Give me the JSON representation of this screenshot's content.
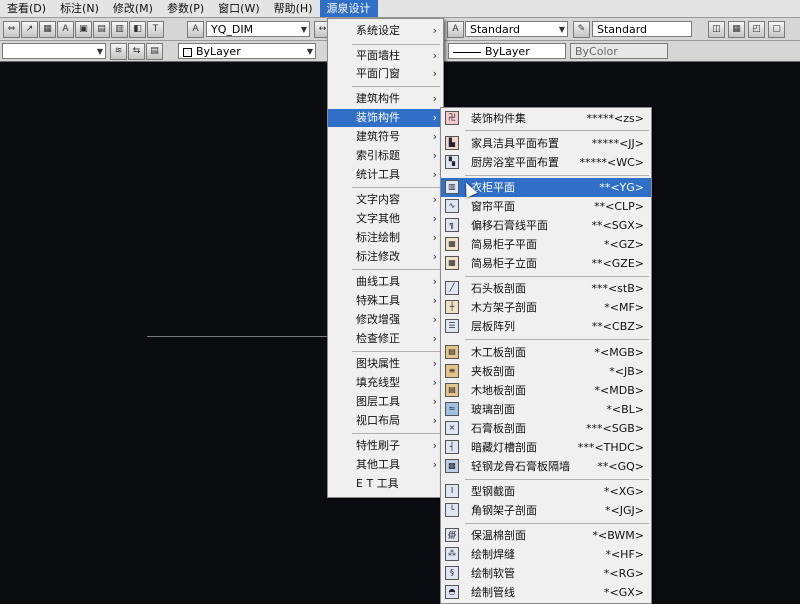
{
  "menubar": {
    "items": [
      {
        "label": "查看(D)"
      },
      {
        "label": "标注(N)"
      },
      {
        "label": "修改(M)"
      },
      {
        "label": "参数(P)"
      },
      {
        "label": "窗口(W)"
      },
      {
        "label": "帮助(H)"
      },
      {
        "label": "源泉设计"
      }
    ]
  },
  "toolbar1": {
    "dim_style": "YQ_DIM",
    "text_style": "Standard",
    "table_style": "Standard"
  },
  "toolbar2": {
    "layer_color": "ByLayer",
    "linetype": "ByLayer",
    "plot_style": "ByColor"
  },
  "main_menu": {
    "items": [
      {
        "label": "系统设定",
        "has_sub": true
      },
      {
        "label": "平面墙柱",
        "has_sub": true
      },
      {
        "label": "平面门窗",
        "has_sub": true
      },
      {
        "label": "建筑构件",
        "has_sub": true
      },
      {
        "label": "装饰构件",
        "has_sub": true,
        "highlighted": true
      },
      {
        "label": "建筑符号",
        "has_sub": true
      },
      {
        "label": "索引标题",
        "has_sub": true
      },
      {
        "label": "统计工具",
        "has_sub": true
      },
      {
        "label": "文字内容",
        "has_sub": true
      },
      {
        "label": "文字其他",
        "has_sub": true
      },
      {
        "label": "标注绘制",
        "has_sub": true
      },
      {
        "label": "标注修改",
        "has_sub": true
      },
      {
        "label": "曲线工具",
        "has_sub": true
      },
      {
        "label": "特殊工具",
        "has_sub": true
      },
      {
        "label": "修改增强",
        "has_sub": true
      },
      {
        "label": "检查修正",
        "has_sub": true
      },
      {
        "label": "图块属性",
        "has_sub": true
      },
      {
        "label": "填充线型",
        "has_sub": true
      },
      {
        "label": "图层工具",
        "has_sub": true
      },
      {
        "label": "视口布局",
        "has_sub": true
      },
      {
        "label": "特性刷子",
        "has_sub": true
      },
      {
        "label": "其他工具",
        "has_sub": true
      },
      {
        "label": "E T 工具",
        "has_sub": false
      }
    ]
  },
  "sub_menu": {
    "items": [
      {
        "label": "装饰构件集",
        "code": "*****<zs>",
        "icon": "decor-set-icon"
      },
      {
        "label": "家具洁具平面布置",
        "code": "*****<JJ>",
        "icon": "furniture-icon"
      },
      {
        "label": "厨房浴室平面布置",
        "code": "*****<WC>",
        "icon": "kitchen-icon"
      },
      {
        "label": "衣柜平面",
        "code": "**<YG>",
        "icon": "wardrobe-icon",
        "highlighted": true
      },
      {
        "label": "窗帘平面",
        "code": "**<CLP>",
        "icon": "curtain-icon"
      },
      {
        "label": "偏移石膏线平面",
        "code": "**<SGX>",
        "icon": "gypsum-line-icon"
      },
      {
        "label": "简易柜子平面",
        "code": "*<GZ>",
        "icon": "cabinet-plan-icon"
      },
      {
        "label": "简易柜子立面",
        "code": "**<GZE>",
        "icon": "cabinet-elev-icon"
      },
      {
        "label": "石头板剖面",
        "code": "***<stB>",
        "icon": "stone-board-icon"
      },
      {
        "label": "木方架子剖面",
        "code": "*<MF>",
        "icon": "wood-frame-icon"
      },
      {
        "label": "层板阵列",
        "code": "**<CBZ>",
        "icon": "shelf-array-icon"
      },
      {
        "label": "木工板剖面",
        "code": "*<MGB>",
        "icon": "woodboard-icon"
      },
      {
        "label": "夹板剖面",
        "code": "*<JB>",
        "icon": "plywood-icon"
      },
      {
        "label": "木地板剖面",
        "code": "*<MDB>",
        "icon": "wood-floor-icon"
      },
      {
        "label": "玻璃剖面",
        "code": "*<BL>",
        "icon": "glass-icon"
      },
      {
        "label": "石膏板剖面",
        "code": "***<SGB>",
        "icon": "gypsum-board-icon"
      },
      {
        "label": "暗藏灯槽剖面",
        "code": "***<THDC>",
        "icon": "light-trough-icon"
      },
      {
        "label": "轻钢龙骨石膏板隔墙",
        "code": "**<GQ>",
        "icon": "steel-keel-icon"
      },
      {
        "label": "型钢截面",
        "code": "*<XG>",
        "icon": "steel-section-icon"
      },
      {
        "label": "角钢架子剖面",
        "code": "*<JGJ>",
        "icon": "angle-steel-icon"
      },
      {
        "label": "保温棉剖面",
        "code": "*<BWM>",
        "icon": "insulation-icon"
      },
      {
        "label": "绘制焊缝",
        "code": "*<HF>",
        "icon": "weld-icon"
      },
      {
        "label": "绘制软管",
        "code": "*<RG>",
        "icon": "hose-icon"
      },
      {
        "label": "绘制管线",
        "code": "*<GX>",
        "icon": "pipe-icon"
      }
    ]
  }
}
